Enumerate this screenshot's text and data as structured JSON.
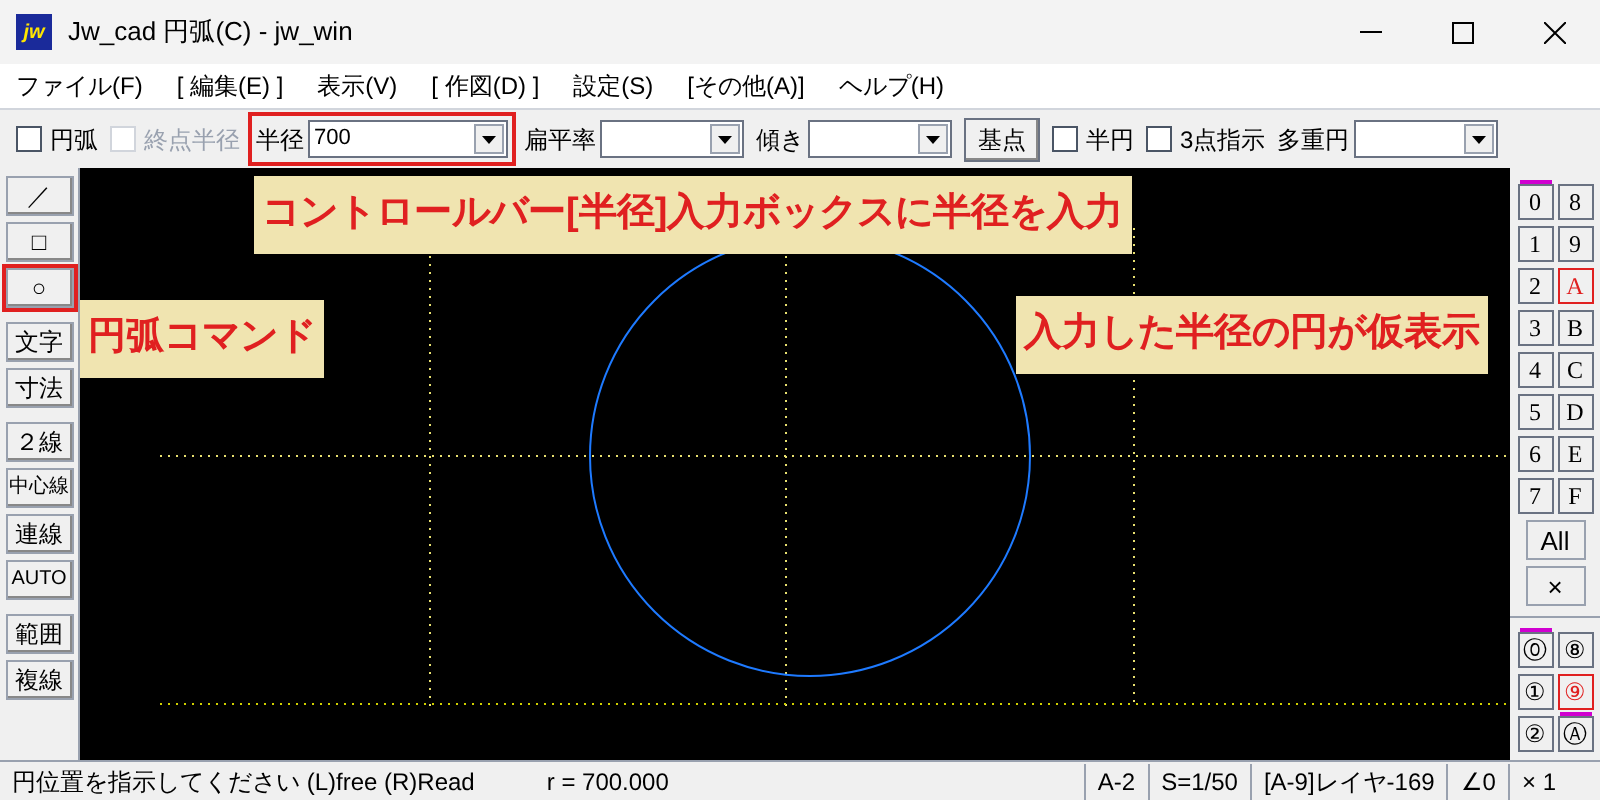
{
  "window": {
    "title": "Jw_cad 円弧(C) - jw_win",
    "app_icon": "jw"
  },
  "menu": [
    "ファイル(F)",
    "[ 編集(E) ]",
    "表示(V)",
    "[ 作図(D) ]",
    "設定(S)",
    "[その他(A)]",
    "ヘルプ(H)"
  ],
  "control_bar": [
    {
      "kind": "checkbox",
      "label": "円弧",
      "checked": false,
      "disabled": false
    },
    {
      "kind": "checkbox",
      "label": "終点半径",
      "checked": false,
      "disabled": true
    },
    {
      "kind": "combo",
      "label": "半径",
      "value": "700",
      "highlighted": true
    },
    {
      "kind": "combo",
      "label": "扁平率",
      "highlighted": false
    },
    {
      "kind": "combo",
      "label": "傾き",
      "highlighted": false
    },
    {
      "kind": "button",
      "label": "基点"
    },
    {
      "kind": "checkbox",
      "label": "半円",
      "checked": false,
      "disabled": false
    },
    {
      "kind": "checkbox",
      "label": "3点指示",
      "checked": false,
      "disabled": false
    },
    {
      "kind": "combo",
      "label": "多重円",
      "highlighted": false
    }
  ],
  "tools": [
    {
      "label": "／",
      "selected": false
    },
    {
      "label": "□",
      "selected": false
    },
    {
      "label": "○",
      "selected": true
    },
    {
      "label": "文字",
      "selected": false
    },
    {
      "label": "寸法",
      "selected": false
    },
    {
      "label": "２線",
      "selected": false
    },
    {
      "label": "中心線",
      "selected": false
    },
    {
      "label": "連線",
      "selected": false
    },
    {
      "label": "AUTO",
      "selected": false
    },
    {
      "label": "範囲",
      "selected": false
    },
    {
      "label": "複線",
      "selected": false
    }
  ],
  "callouts": [
    {
      "text": "コントロールバー[半径]入力ボックスに半径を入力"
    },
    {
      "text": "円弧コマンド"
    },
    {
      "text": "入力した半径の円が仮表示"
    }
  ],
  "layers": [
    {
      "label": "0",
      "selected": false,
      "marked": true
    },
    {
      "label": "8",
      "selected": false,
      "marked": false
    },
    {
      "label": "1",
      "selected": false,
      "marked": false
    },
    {
      "label": "9",
      "selected": false,
      "marked": false
    },
    {
      "label": "2",
      "selected": false,
      "marked": false
    },
    {
      "label": "A",
      "selected": true,
      "marked": false
    },
    {
      "label": "3",
      "selected": false,
      "marked": false
    },
    {
      "label": "B",
      "selected": false,
      "marked": false
    },
    {
      "label": "4",
      "selected": false,
      "marked": false
    },
    {
      "label": "C",
      "selected": false,
      "marked": false
    },
    {
      "label": "5",
      "selected": false,
      "marked": false
    },
    {
      "label": "D",
      "selected": false,
      "marked": false
    },
    {
      "label": "6",
      "selected": false,
      "marked": false
    },
    {
      "label": "E",
      "selected": false,
      "marked": false
    },
    {
      "label": "7",
      "selected": false,
      "marked": false
    },
    {
      "label": "F",
      "selected": false,
      "marked": false
    }
  ],
  "layer_buttons": [
    "All",
    "×"
  ],
  "layer_groups": [
    {
      "label": "⓪",
      "selected": false,
      "marked": true
    },
    {
      "label": "⑧",
      "selected": false,
      "marked": false
    },
    {
      "label": "①",
      "selected": false,
      "marked": false
    },
    {
      "label": "⑨",
      "selected": true,
      "marked": false
    },
    {
      "label": "②",
      "selected": false,
      "marked": false
    },
    {
      "label": "Ⓐ",
      "selected": false,
      "marked": true
    }
  ],
  "status_bar": {
    "message": "円位置を指示してください (L)free (R)Read",
    "radius": "r = 700.000",
    "cells": [
      "A-2",
      "S=1/50",
      "[A-9]レイヤ-169",
      "∠0",
      "× 1"
    ]
  }
}
